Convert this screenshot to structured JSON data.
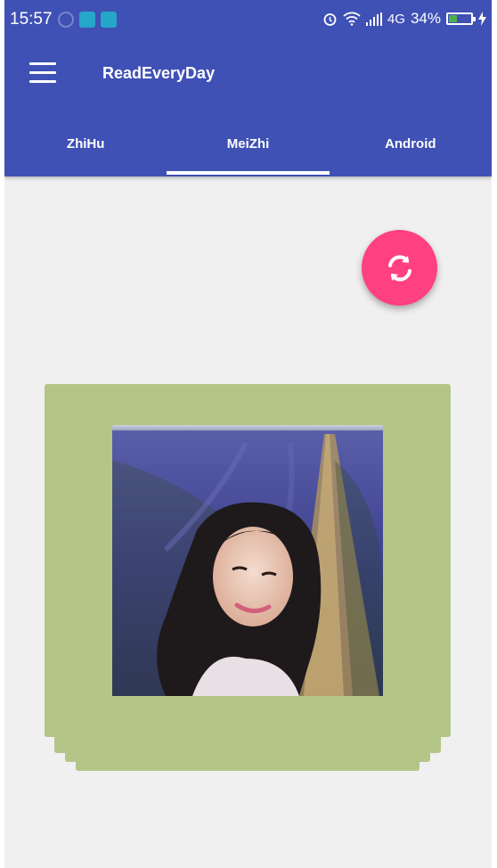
{
  "status_bar": {
    "time": "15:57",
    "network": "4G",
    "battery_percent": "34%",
    "icons": [
      "notification-icon",
      "screenshot-icon",
      "usb-icon",
      "alarm-icon",
      "wifi-icon",
      "signal-icon",
      "battery-icon",
      "charging-icon"
    ]
  },
  "toolbar": {
    "title": "ReadEveryDay",
    "menu_icon": "hamburger-menu-icon"
  },
  "tabs": [
    {
      "label": "ZhiHu",
      "active": false
    },
    {
      "label": "MeiZhi",
      "active": true
    },
    {
      "label": "Android",
      "active": false
    }
  ],
  "fab": {
    "icon": "refresh-icon"
  },
  "colors": {
    "primary": "#3f51b5",
    "accent": "#ff4081",
    "card": "#b3c687",
    "background": "#f0f0f0"
  }
}
